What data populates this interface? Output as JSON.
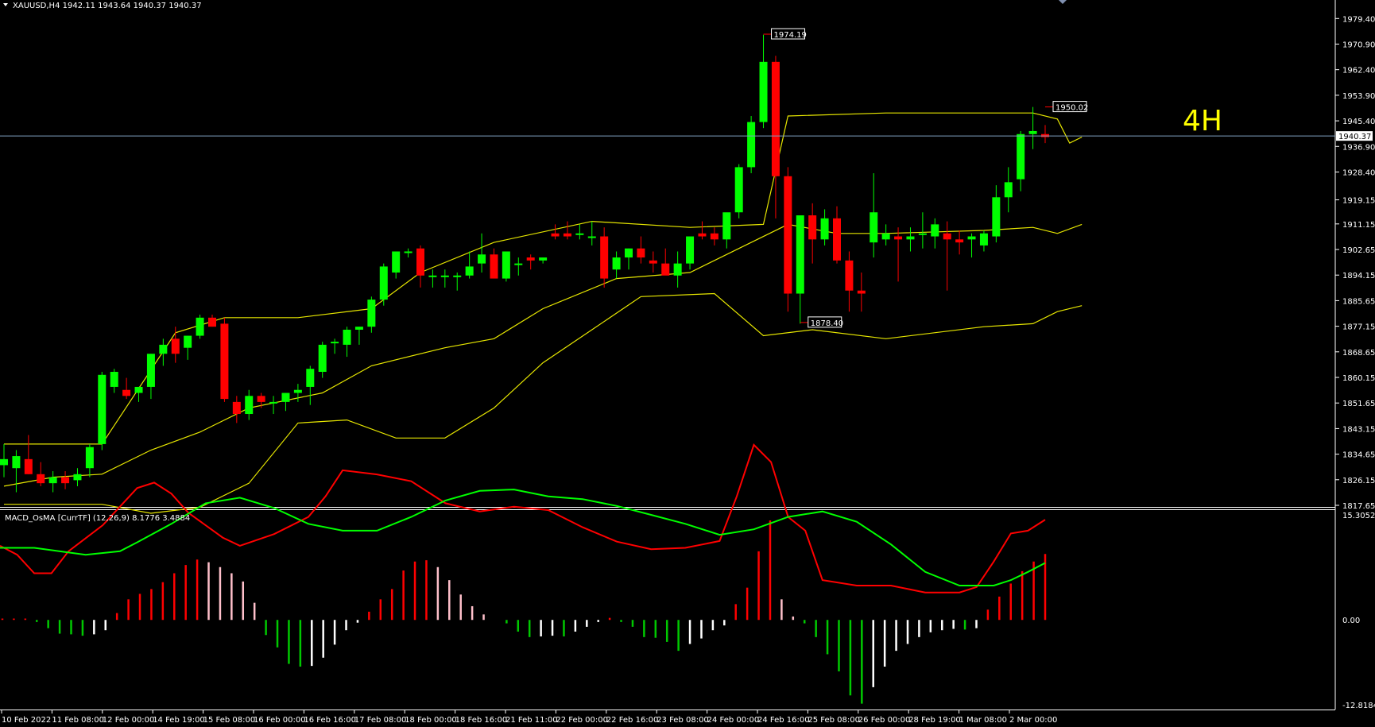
{
  "header": {
    "symbol_title": "XAUUSD,H4  1942.11 1943.64 1940.37 1940.37",
    "indicator_title": "MACD_OsMA [CurrTF] (12,26,9) 8.1776 3.4884",
    "timeframe_note": "4H"
  },
  "colors": {
    "background": "#000000",
    "frame": "#ffffff",
    "bull": "#00ff00",
    "bear": "#ff0000",
    "bands": "#e6e600",
    "bid_line": "#7f9fbf",
    "macd_line": "#ff0000",
    "signal_line": "#00ff00",
    "note": "#ffff00"
  },
  "chart_data": [
    {
      "type": "candlestick",
      "symbol": "XAUUSD",
      "timeframe": "H4",
      "ylim": [
        1817.65,
        1983.7
      ],
      "y_ticks": [
        "1979.40",
        "1970.90",
        "1962.40",
        "1953.90",
        "1945.40",
        "1936.90",
        "1928.40",
        "1919.15",
        "1911.15",
        "1902.65",
        "1894.15",
        "1885.65",
        "1877.15",
        "1868.65",
        "1860.15",
        "1851.65",
        "1843.15",
        "1834.65",
        "1826.15",
        "1817.65"
      ],
      "x_ticks": [
        "10 Feb 2022",
        "11 Feb 08:00",
        "12 Feb 00:00",
        "14 Feb 19:00",
        "15 Feb 08:00",
        "16 Feb 00:00",
        "16 Feb 16:00",
        "17 Feb 08:00",
        "18 Feb 00:00",
        "18 Feb 16:00",
        "21 Feb 11:00",
        "22 Feb 00:00",
        "22 Feb 16:00",
        "23 Feb 08:00",
        "24 Feb 00:00",
        "24 Feb 16:00",
        "25 Feb 08:00",
        "26 Feb 00:00",
        "28 Feb 19:00",
        "1 Mar 08:00",
        "2 Mar 00:00"
      ],
      "current_price": "1940.37",
      "annotations": [
        "1974.19",
        "1878.40",
        "1950.02"
      ],
      "ohlc": [
        [
          1831,
          1838,
          1827,
          1833
        ],
        [
          1830,
          1836,
          1822,
          1834
        ],
        [
          1833,
          1841,
          1828,
          1828
        ],
        [
          1828,
          1832,
          1824,
          1825
        ],
        [
          1825,
          1829,
          1822,
          1827
        ],
        [
          1827,
          1829,
          1823,
          1825
        ],
        [
          1826,
          1830,
          1824,
          1828
        ],
        [
          1830,
          1838,
          1827,
          1837
        ],
        [
          1838,
          1862,
          1836,
          1861
        ],
        [
          1857,
          1863,
          1855,
          1862
        ],
        [
          1856,
          1860,
          1853,
          1854
        ],
        [
          1855,
          1857,
          1852,
          1857
        ],
        [
          1857,
          1868,
          1853,
          1868
        ],
        [
          1868,
          1873,
          1864,
          1871
        ],
        [
          1873,
          1877,
          1865,
          1868
        ],
        [
          1870,
          1874,
          1866,
          1874
        ],
        [
          1874,
          1881,
          1873,
          1880
        ],
        [
          1880,
          1881,
          1877,
          1877
        ],
        [
          1878,
          1880,
          1852,
          1853
        ],
        [
          1852,
          1854,
          1845,
          1848
        ],
        [
          1848,
          1856,
          1846,
          1854
        ],
        [
          1854,
          1855,
          1850,
          1852
        ],
        [
          1852,
          1854,
          1848,
          1852
        ],
        [
          1852,
          1855,
          1849,
          1855
        ],
        [
          1855,
          1858,
          1852,
          1856
        ],
        [
          1857,
          1864,
          1851,
          1863
        ],
        [
          1862,
          1872,
          1860,
          1871
        ],
        [
          1872,
          1873,
          1868,
          1872
        ],
        [
          1871,
          1877,
          1867,
          1876
        ],
        [
          1876,
          1877,
          1871,
          1877
        ],
        [
          1877,
          1887,
          1875,
          1886
        ],
        [
          1886,
          1898,
          1884,
          1897
        ],
        [
          1895,
          1902,
          1893,
          1902
        ],
        [
          1902,
          1903,
          1900,
          1902
        ],
        [
          1903,
          1904,
          1890,
          1894
        ],
        [
          1894,
          1896,
          1890,
          1894
        ],
        [
          1894,
          1896,
          1890,
          1894
        ],
        [
          1894,
          1895,
          1889,
          1894
        ],
        [
          1894,
          1902,
          1893,
          1897
        ],
        [
          1898,
          1908,
          1895,
          1901
        ],
        [
          1901,
          1903,
          1894,
          1893
        ],
        [
          1893,
          1901,
          1892,
          1902
        ],
        [
          1898,
          1900,
          1894,
          1898
        ],
        [
          1900,
          1901,
          1896,
          1899
        ],
        [
          1899,
          1900,
          1898,
          1900
        ],
        [
          1908,
          1911,
          1906,
          1907
        ],
        [
          1908,
          1912,
          1906,
          1907
        ],
        [
          1908,
          1911,
          1906,
          1908
        ],
        [
          1907,
          1912,
          1904,
          1907
        ],
        [
          1907,
          1910,
          1890,
          1893
        ],
        [
          1896,
          1902,
          1893,
          1900
        ],
        [
          1900,
          1903,
          1896,
          1903
        ],
        [
          1903,
          1907,
          1898,
          1900
        ],
        [
          1899,
          1902,
          1895,
          1898
        ],
        [
          1898,
          1903,
          1897,
          1894
        ],
        [
          1894,
          1902,
          1890,
          1898
        ],
        [
          1898,
          1906,
          1896,
          1907
        ],
        [
          1908,
          1912,
          1906,
          1907
        ],
        [
          1908,
          1910,
          1904,
          1906
        ],
        [
          1906,
          1909,
          1903,
          1915
        ],
        [
          1915,
          1931,
          1913,
          1930
        ],
        [
          1930,
          1947,
          1928,
          1945
        ],
        [
          1945,
          1974,
          1943,
          1965
        ],
        [
          1965,
          1967,
          1913,
          1927
        ],
        [
          1927,
          1930,
          1882,
          1888
        ],
        [
          1888,
          1912,
          1878,
          1914
        ],
        [
          1914,
          1918,
          1898,
          1906
        ],
        [
          1906,
          1916,
          1904,
          1913
        ],
        [
          1913,
          1917,
          1898,
          1899
        ],
        [
          1899,
          1902,
          1882,
          1889
        ],
        [
          1889,
          1895,
          1882,
          1888
        ],
        [
          1905,
          1928,
          1900,
          1915
        ],
        [
          1906,
          1911,
          1904,
          1908
        ],
        [
          1907,
          1910,
          1892,
          1906
        ],
        [
          1906,
          1910,
          1902,
          1907
        ],
        [
          1908,
          1915,
          1903,
          1908
        ],
        [
          1907,
          1913,
          1903,
          1911
        ],
        [
          1908,
          1912,
          1889,
          1906
        ],
        [
          1906,
          1909,
          1901,
          1905
        ],
        [
          1906,
          1908,
          1900,
          1907
        ],
        [
          1904,
          1909,
          1902,
          1908
        ],
        [
          1907,
          1924,
          1905,
          1920
        ],
        [
          1920,
          1930,
          1915,
          1925
        ],
        [
          1926,
          1942,
          1922,
          1941
        ],
        [
          1941,
          1950,
          1936,
          1942
        ],
        [
          1941,
          1944,
          1938,
          1940
        ]
      ],
      "bollinger_upper": [
        [
          0,
          1838
        ],
        [
          8,
          1838
        ],
        [
          14,
          1875
        ],
        [
          18,
          1880
        ],
        [
          24,
          1880
        ],
        [
          30,
          1883
        ],
        [
          34,
          1895
        ],
        [
          40,
          1905
        ],
        [
          48,
          1912
        ],
        [
          56,
          1910
        ],
        [
          62,
          1911
        ],
        [
          64,
          1947
        ],
        [
          72,
          1948
        ],
        [
          84,
          1948
        ],
        [
          86,
          1946
        ],
        [
          87,
          1938
        ],
        [
          88,
          1940
        ]
      ],
      "bollinger_middle": [
        [
          0,
          1824
        ],
        [
          4,
          1827
        ],
        [
          8,
          1828
        ],
        [
          12,
          1836
        ],
        [
          16,
          1842
        ],
        [
          20,
          1850
        ],
        [
          26,
          1855
        ],
        [
          30,
          1864
        ],
        [
          36,
          1870
        ],
        [
          40,
          1873
        ],
        [
          44,
          1883
        ],
        [
          50,
          1893
        ],
        [
          56,
          1895
        ],
        [
          60,
          1903
        ],
        [
          64,
          1911
        ],
        [
          68,
          1908
        ],
        [
          72,
          1908
        ],
        [
          80,
          1909
        ],
        [
          84,
          1910
        ],
        [
          86,
          1908
        ],
        [
          88,
          1911
        ]
      ],
      "bollinger_lower": [
        [
          0,
          1818
        ],
        [
          8,
          1818
        ],
        [
          12,
          1815
        ],
        [
          16,
          1817
        ],
        [
          20,
          1825
        ],
        [
          24,
          1845
        ],
        [
          28,
          1846
        ],
        [
          32,
          1840
        ],
        [
          36,
          1840
        ],
        [
          40,
          1850
        ],
        [
          44,
          1865
        ],
        [
          48,
          1876
        ],
        [
          52,
          1887
        ],
        [
          58,
          1888
        ],
        [
          62,
          1874
        ],
        [
          66,
          1876
        ],
        [
          72,
          1873
        ],
        [
          80,
          1877
        ],
        [
          84,
          1878
        ],
        [
          86,
          1882
        ],
        [
          88,
          1884
        ]
      ]
    },
    {
      "type": "bar",
      "name": "MACD_OsMA",
      "ylim": [
        -12.8184,
        15.3052
      ],
      "y_ticks": [
        "15.3052",
        "0.00",
        "-12.8184"
      ],
      "histogram": [
        0.2,
        0.2,
        0.2,
        -0.3,
        -1.2,
        -2.0,
        -2.1,
        -2.3,
        -2.1,
        -1.5,
        1.0,
        3.0,
        3.8,
        4.5,
        5.5,
        6.8,
        8.0,
        8.8,
        8.4,
        7.7,
        6.8,
        5.6,
        2.5,
        -2.2,
        -4.0,
        -6.4,
        -6.8,
        -6.7,
        -5.5,
        -3.6,
        -1.5,
        -0.4,
        1.2,
        3.0,
        4.5,
        7.2,
        8.5,
        8.7,
        7.7,
        5.8,
        3.7,
        2.0,
        0.8,
        0,
        -0.5,
        -1.7,
        -2.5,
        -2.4,
        -2.3,
        -2.4,
        -1.7,
        -1.0,
        -0.3,
        0.3,
        -0.3,
        -1.0,
        -2.5,
        -2.6,
        -3.2,
        -4.5,
        -3.5,
        -2.7,
        -1.5,
        -0.8,
        2.3,
        4.7,
        10.0,
        14.5,
        3.0,
        0.5,
        -0.5,
        -2.5,
        -5.0,
        -7.5,
        -11.0,
        -12.2,
        -9.8,
        -6.8,
        -4.5,
        -3.5,
        -2.5,
        -1.8,
        -1.5,
        -1.3,
        -1.4,
        -1.2,
        1.5,
        3.4,
        5.3,
        7.1,
        8.5,
        9.6
      ],
      "macd_line": [
        [
          0,
          10.8
        ],
        [
          2,
          9.5
        ],
        [
          4,
          6.8
        ],
        [
          6,
          6.8
        ],
        [
          8,
          10.0
        ],
        [
          12,
          13.8
        ],
        [
          16,
          19.2
        ],
        [
          18,
          20.0
        ],
        [
          20,
          18.4
        ],
        [
          22,
          15.6
        ],
        [
          26,
          12.0
        ],
        [
          28,
          10.8
        ],
        [
          32,
          12.5
        ],
        [
          36,
          15.0
        ],
        [
          38,
          18.0
        ],
        [
          40,
          21.8
        ],
        [
          44,
          21.2
        ],
        [
          48,
          20.2
        ],
        [
          52,
          17.0
        ],
        [
          56,
          15.8
        ],
        [
          60,
          16.5
        ],
        [
          64,
          16.0
        ],
        [
          68,
          13.5
        ],
        [
          72,
          11.4
        ],
        [
          76,
          10.3
        ],
        [
          80,
          10.5
        ],
        [
          84,
          11.5
        ],
        [
          86,
          18.0
        ],
        [
          88,
          25.5
        ],
        [
          90,
          23.0
        ],
        [
          92,
          15.0
        ],
        [
          94,
          13.0
        ],
        [
          96,
          5.8
        ],
        [
          100,
          5.0
        ],
        [
          104,
          5.0
        ],
        [
          108,
          4.0
        ],
        [
          112,
          4.0
        ],
        [
          114,
          4.8
        ],
        [
          116,
          8.5
        ],
        [
          118,
          12.6
        ],
        [
          120,
          13.0
        ],
        [
          122,
          14.6
        ]
      ],
      "signal_line": [
        [
          0,
          10.5
        ],
        [
          4,
          10.5
        ],
        [
          10,
          9.5
        ],
        [
          14,
          10.0
        ],
        [
          16,
          11.3
        ],
        [
          20,
          14.0
        ],
        [
          24,
          17.0
        ],
        [
          28,
          17.8
        ],
        [
          32,
          16.3
        ],
        [
          36,
          14.0
        ],
        [
          40,
          13.0
        ],
        [
          44,
          13.0
        ],
        [
          48,
          15.0
        ],
        [
          52,
          17.4
        ],
        [
          56,
          18.8
        ],
        [
          60,
          19.0
        ],
        [
          64,
          18.0
        ],
        [
          68,
          17.6
        ],
        [
          72,
          16.6
        ],
        [
          76,
          15.3
        ],
        [
          80,
          14.0
        ],
        [
          84,
          12.4
        ],
        [
          88,
          13.2
        ],
        [
          92,
          15.0
        ],
        [
          96,
          15.8
        ],
        [
          100,
          14.3
        ],
        [
          104,
          11.0
        ],
        [
          108,
          7.0
        ],
        [
          112,
          5.0
        ],
        [
          116,
          5.0
        ],
        [
          118,
          5.8
        ],
        [
          120,
          7.0
        ],
        [
          122,
          8.3
        ]
      ]
    }
  ]
}
